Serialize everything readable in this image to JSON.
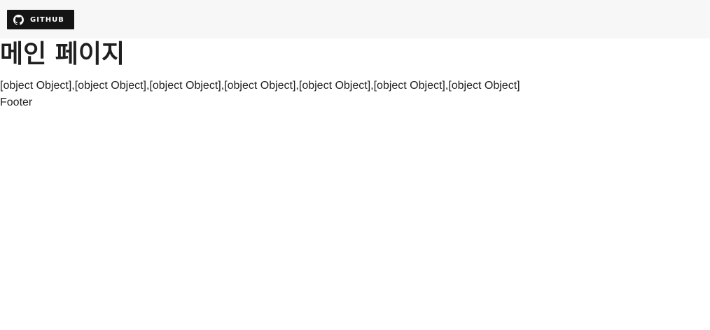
{
  "header": {
    "github_label": "GITHUB",
    "github_icon": "github-icon",
    "background": "#f7f7f8",
    "badge_color": "#141414"
  },
  "main": {
    "title": "메인 페이지",
    "content": "[object Object],[object Object],[object Object],[object Object],[object Object],[object Object],[object Object]"
  },
  "footer": {
    "text": "Footer"
  }
}
